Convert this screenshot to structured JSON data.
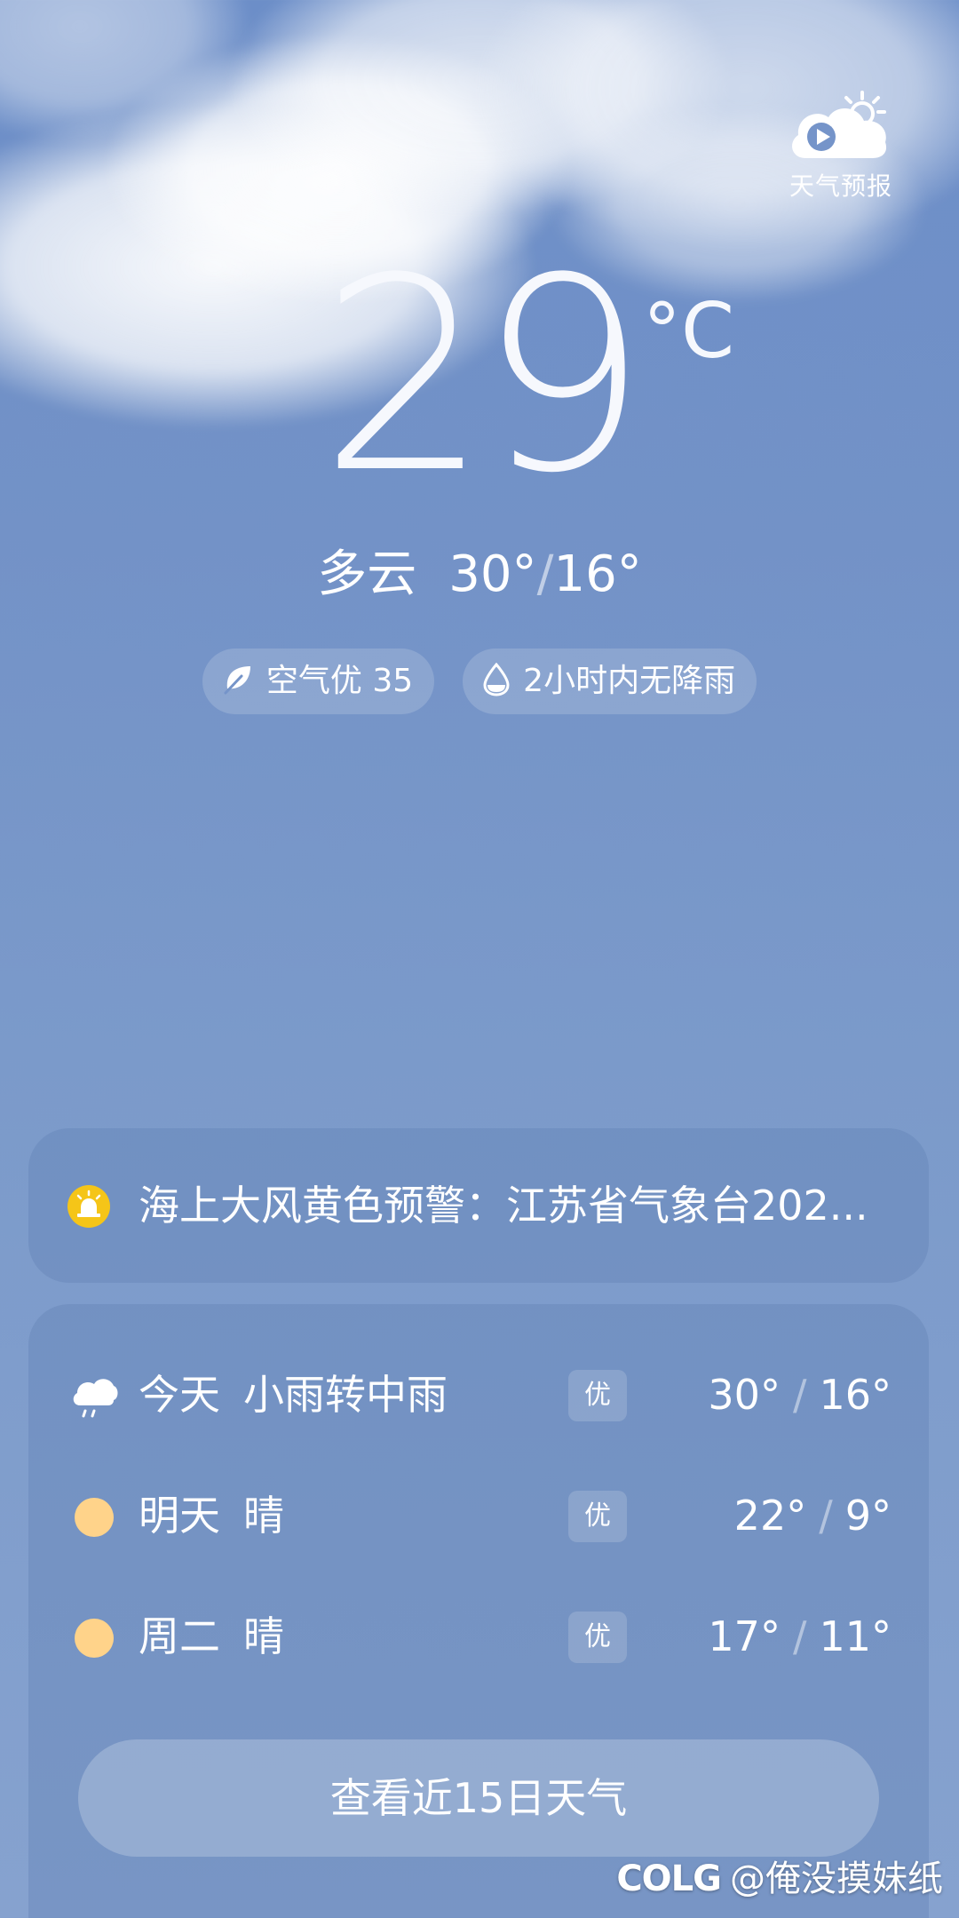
{
  "video_button": {
    "label": "天气预报",
    "icon": "weather-video-icon"
  },
  "current": {
    "temperature": "29",
    "unit": "°C",
    "condition": "多云",
    "high": "30°",
    "low": "16°",
    "separator": "/"
  },
  "pills": {
    "air_quality": {
      "label": "空气优 35",
      "icon": "leaf-icon"
    },
    "precipitation": {
      "label": "2小时内无降雨",
      "icon": "water-drop-icon"
    }
  },
  "alert": {
    "text": "海上大风黄色预警：江苏省气象台202...",
    "icon": "alert-siren-icon",
    "icon_color": "#f5c518"
  },
  "forecast": [
    {
      "day": "今天",
      "condition": "小雨转中雨",
      "aqi": "优",
      "high": "30°",
      "low": "16°",
      "icon": "rain-cloud-icon"
    },
    {
      "day": "明天",
      "condition": "晴",
      "aqi": "优",
      "high": "22°",
      "low": "9°",
      "icon": "sun-icon"
    },
    {
      "day": "周二",
      "condition": "晴",
      "aqi": "优",
      "high": "17°",
      "low": "11°",
      "icon": "sun-icon"
    }
  ],
  "forecast_separator": "/",
  "more_button": {
    "label": "查看近15日天气"
  },
  "watermark": {
    "logo": "COLG",
    "text": "@俺没摸妹纸"
  },
  "colors": {
    "background": "#7392c7",
    "sun": "#ffd38a",
    "alert_yellow": "#f5c518"
  }
}
